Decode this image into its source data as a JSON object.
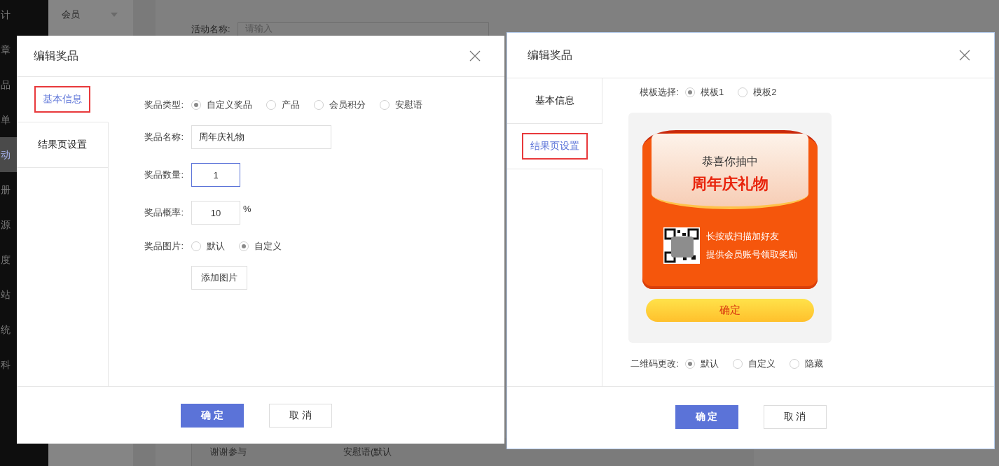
{
  "background": {
    "sidebar_items": [
      {
        "label": "计",
        "selected": false
      },
      {
        "label": "章",
        "selected": false
      },
      {
        "label": "品",
        "selected": false
      },
      {
        "label": "单",
        "selected": false
      },
      {
        "label": "动",
        "selected": true
      },
      {
        "label": "册",
        "selected": false
      },
      {
        "label": "源",
        "selected": false
      },
      {
        "label": "度",
        "selected": false
      },
      {
        "label": "站",
        "selected": false
      },
      {
        "label": "统",
        "selected": false
      },
      {
        "label": "科",
        "selected": false
      }
    ],
    "submenu": {
      "label": "会员"
    },
    "form": {
      "label": "活动名称:",
      "placeholder": "请输入"
    },
    "table_row": [
      "谢谢参与",
      "安慰语(默认"
    ]
  },
  "dialogs": [
    {
      "kind": "basic",
      "title": "编辑奖品",
      "tabs": [
        {
          "label": "基本信息",
          "selected": true,
          "highlighted": true
        },
        {
          "label": "结果页设置",
          "selected": false,
          "highlighted": false
        }
      ],
      "prize_type": {
        "label": "奖品类型:",
        "options": [
          {
            "label": "自定义奖品",
            "selected": true
          },
          {
            "label": "产品",
            "selected": false
          },
          {
            "label": "会员积分",
            "selected": false
          },
          {
            "label": "安慰语",
            "selected": false
          }
        ]
      },
      "name": {
        "label": "奖品名称:",
        "value": "周年庆礼物"
      },
      "quantity": {
        "label": "奖品数量:",
        "value": "1",
        "focused": true
      },
      "probability": {
        "label": "奖品概率:",
        "value": "10",
        "unit": "%"
      },
      "image": {
        "label": "奖品图片:",
        "options": [
          {
            "label": "默认",
            "selected": false
          },
          {
            "label": "自定义",
            "selected": true
          }
        ],
        "button": "添加图片"
      },
      "buttons": [
        {
          "label": "确 定",
          "kind": "primary"
        },
        {
          "label": "取 消",
          "kind": "default"
        }
      ]
    },
    {
      "kind": "result",
      "title": "编辑奖品",
      "tabs": [
        {
          "label": "基本信息",
          "selected": false,
          "highlighted": false
        },
        {
          "label": "结果页设置",
          "selected": true,
          "highlighted": true
        }
      ],
      "template": {
        "label": "模板选择:",
        "options": [
          {
            "label": "模板1",
            "selected": true
          },
          {
            "label": "模板2",
            "selected": false
          }
        ]
      },
      "preview": {
        "greeting": "恭喜你抽中",
        "prize": "周年庆礼物",
        "lines": [
          "长按或扫描加好友",
          "提供会员账号领取奖励"
        ],
        "button": "确定"
      },
      "qr_change": {
        "label": "二维码更改:",
        "options": [
          {
            "label": "默认",
            "selected": true
          },
          {
            "label": "自定义",
            "selected": false
          },
          {
            "label": "隐藏",
            "selected": false
          }
        ]
      },
      "buttons": [
        {
          "label": "确 定",
          "kind": "primary"
        },
        {
          "label": "取 消",
          "kind": "default"
        }
      ]
    }
  ]
}
